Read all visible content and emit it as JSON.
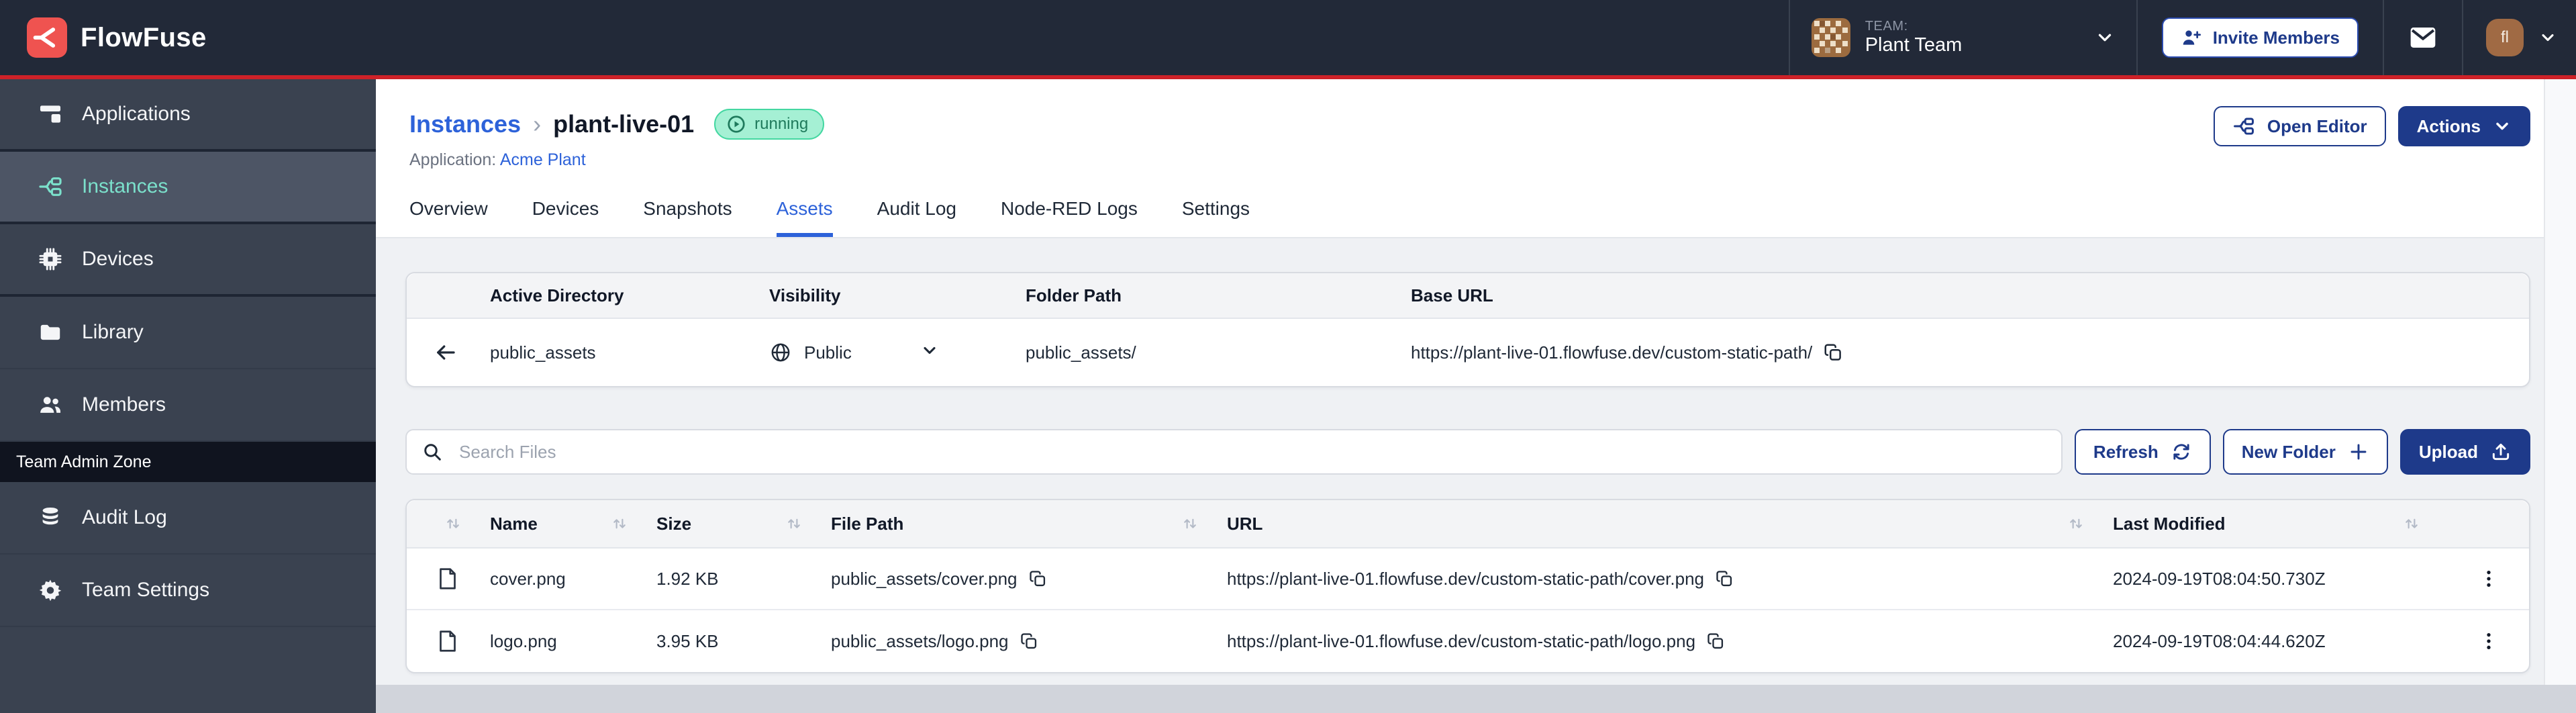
{
  "colors": {
    "header_bg": "#222938",
    "red_line": "#CE2128",
    "logo_red": "#EF5350",
    "sidebar_bg": "#3A4250",
    "sidebar_active_bg": "#4D5565",
    "teal": "#7BE0CB",
    "navy": "#1E3A8A",
    "link_blue": "#2D62D9",
    "badge_bg": "#A5F0D4",
    "badge_border": "#44D7A1",
    "content_bg": "#EFF1F4",
    "head_gray": "#F3F4F6",
    "card_border": "#D8DBE1",
    "band": "#D1D4DB"
  },
  "brand": {
    "name": "FlowFuse"
  },
  "header": {
    "team_label": "TEAM:",
    "team_name": "Plant Team",
    "invite_button": "Invite Members",
    "user_initials": "fl"
  },
  "sidebar": {
    "items": [
      {
        "label": "Applications",
        "icon": "applications-icon"
      },
      {
        "label": "Instances",
        "icon": "instances-icon"
      },
      {
        "label": "Devices",
        "icon": "devices-icon"
      },
      {
        "label": "Library",
        "icon": "library-icon"
      },
      {
        "label": "Members",
        "icon": "members-icon"
      }
    ],
    "admin_zone_label": "Team Admin Zone",
    "admin_items": [
      {
        "label": "Audit Log",
        "icon": "audit-log-icon"
      },
      {
        "label": "Team Settings",
        "icon": "gear-icon"
      }
    ]
  },
  "breadcrumb": {
    "parent": "Instances",
    "separator": "›",
    "current": "plant-live-01",
    "status": "running",
    "application_label": "Application:",
    "application_name": "Acme Plant"
  },
  "page_actions": {
    "open_editor": "Open Editor",
    "actions": "Actions"
  },
  "tabs": {
    "items": [
      "Overview",
      "Devices",
      "Snapshots",
      "Assets",
      "Audit Log",
      "Node-RED Logs",
      "Settings"
    ],
    "active": "Assets"
  },
  "directory": {
    "headers": [
      "Active Directory",
      "Visibility",
      "Folder Path",
      "Base URL"
    ],
    "row": {
      "name": "public_assets",
      "visibility": "Public",
      "folder_path": "public_assets/",
      "base_url": "https://plant-live-01.flowfuse.dev/custom-static-path/"
    }
  },
  "toolbar": {
    "search_placeholder": "Search Files",
    "refresh": "Refresh",
    "new_folder": "New Folder",
    "upload": "Upload"
  },
  "files": {
    "headers": [
      "Name",
      "Size",
      "File Path",
      "URL",
      "Last Modified"
    ],
    "rows": [
      {
        "name": "cover.png",
        "size": "1.92 KB",
        "file_path": "public_assets/cover.png",
        "url": "https://plant-live-01.flowfuse.dev/custom-static-path/cover.png",
        "last_modified": "2024-09-19T08:04:50.730Z"
      },
      {
        "name": "logo.png",
        "size": "3.95 KB",
        "file_path": "public_assets/logo.png",
        "url": "https://plant-live-01.flowfuse.dev/custom-static-path/logo.png",
        "last_modified": "2024-09-19T08:04:44.620Z"
      }
    ]
  }
}
